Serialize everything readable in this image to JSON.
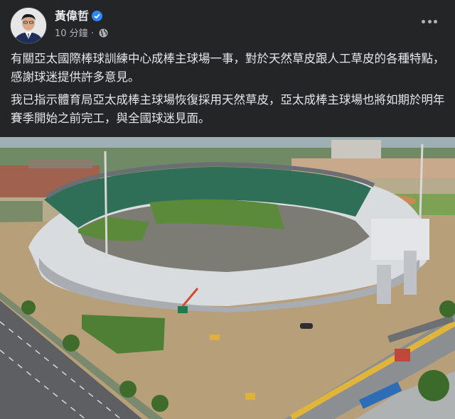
{
  "post": {
    "author": "黃偉哲",
    "time": "10 分鐘",
    "separator": "·",
    "paragraphs": [
      "有關亞太國際棒球訓練中心成棒主球場一事，對於天然草皮跟人工草皮的各種特點，感謝球迷提供許多意見。",
      "我已指示體育局亞太成棒主球場恢復採用天然草皮，亞太成棒主球場也將如期於明年賽季開始之前完工，與全國球迷見面。"
    ]
  },
  "icons": {
    "verified": "verified-badge-icon",
    "audience": "globe-icon",
    "menu": "more-options-icon"
  },
  "colors": {
    "background": "#242526",
    "text": "#e4e6eb",
    "secondary": "#b0b3b8",
    "verified": "#2d88ff"
  }
}
